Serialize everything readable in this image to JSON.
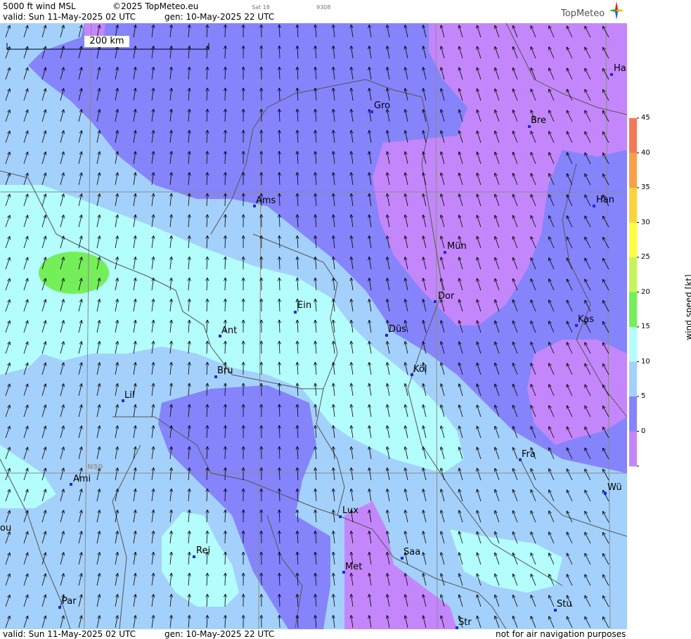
{
  "header": {
    "product": "5000 ft wind MSL",
    "copyright": "©2025 TopMeteo.eu",
    "sat_label": "Sat 18",
    "code": "9308",
    "valid": "valid:  Sun  11-May-2025  02 UTC",
    "gen": "gen: 10-May-2025 22 UTC",
    "logo": "TopMeteo"
  },
  "footer": {
    "valid": "valid:  Sun  11-May-2025  02 UTC",
    "gen": "gen: 10-May-2025 22 UTC",
    "disclaimer": "not for air navigation purposes"
  },
  "map": {
    "scale_label": "200 km",
    "lat_label": "N50",
    "cities": [
      {
        "name": "Gro"
      },
      {
        "name": "Bre"
      },
      {
        "name": "Ha"
      },
      {
        "name": "Ams"
      },
      {
        "name": "Han"
      },
      {
        "name": "Mün"
      },
      {
        "name": "Ein"
      },
      {
        "name": "Dor"
      },
      {
        "name": "Kas"
      },
      {
        "name": "Ant"
      },
      {
        "name": "Düs"
      },
      {
        "name": "Köl"
      },
      {
        "name": "Bru"
      },
      {
        "name": "Lil"
      },
      {
        "name": "Fra"
      },
      {
        "name": "Ami"
      },
      {
        "name": "Wü"
      },
      {
        "name": "Lux"
      },
      {
        "name": "ou"
      },
      {
        "name": "Rei"
      },
      {
        "name": "Saa"
      },
      {
        "name": "Met"
      },
      {
        "name": "Par"
      },
      {
        "name": "Stu"
      },
      {
        "name": "Str"
      }
    ]
  },
  "legend": {
    "title": "wind  speed  [kt]",
    "ticks": [
      "45",
      "40",
      "35",
      "30",
      "25",
      "20",
      "15",
      "10",
      "5",
      "0"
    ],
    "colors": [
      "#f27a5a",
      "#f6a04e",
      "#fbd33e",
      "#fefd45",
      "#c6f55a",
      "#74ef59",
      "#b4fdfd",
      "#a4d1fb",
      "#8584fb",
      "#c487fb"
    ]
  }
}
